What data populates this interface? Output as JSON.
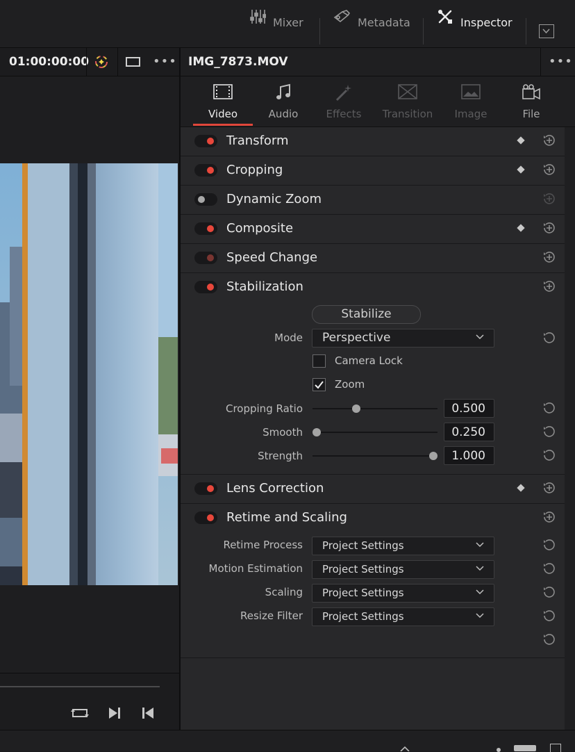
{
  "topbar": {
    "mixer_label": "Mixer",
    "metadata_label": "Metadata",
    "inspector_label": "Inspector",
    "icons": [
      "mixer-icon",
      "metadata-icon",
      "inspector-icon",
      "expand-icon"
    ]
  },
  "viewer": {
    "timecode": "01:00:00:00",
    "icons": [
      "color-wheel-icon",
      "aspect-ratio-icon",
      "more-options-icon",
      "loop-icon",
      "next-frame-icon",
      "previous-frame-icon"
    ]
  },
  "inspector": {
    "clip_name": "IMG_7873.MOV",
    "tabs": [
      {
        "label": "Video",
        "state": "active"
      },
      {
        "label": "Audio",
        "state": "normal"
      },
      {
        "label": "Effects",
        "state": "disabled"
      },
      {
        "label": "Transition",
        "state": "disabled"
      },
      {
        "label": "Image",
        "state": "disabled"
      },
      {
        "label": "File",
        "state": "normal"
      }
    ],
    "sections": {
      "transform": {
        "title": "Transform",
        "enabled": true
      },
      "cropping": {
        "title": "Cropping",
        "enabled": true
      },
      "dynamic_zoom": {
        "title": "Dynamic Zoom",
        "enabled": false
      },
      "composite": {
        "title": "Composite",
        "enabled": true
      },
      "speed_change": {
        "title": "Speed Change",
        "enabled": "partial"
      },
      "stabilization": {
        "title": "Stabilization",
        "enabled": true
      },
      "lens_correction": {
        "title": "Lens Correction",
        "enabled": true
      },
      "retime_scaling": {
        "title": "Retime and Scaling",
        "enabled": true
      }
    },
    "stabilization": {
      "stabilize_button": "Stabilize",
      "mode_label": "Mode",
      "mode_value": "Perspective",
      "camera_lock_label": "Camera Lock",
      "camera_lock_checked": false,
      "zoom_label": "Zoom",
      "zoom_checked": true,
      "cropping_ratio_label": "Cropping Ratio",
      "cropping_ratio_value": "0.500",
      "cropping_ratio_slider": 0.34,
      "smooth_label": "Smooth",
      "smooth_value": "0.250",
      "smooth_slider": 0.0,
      "strength_label": "Strength",
      "strength_value": "1.000",
      "strength_slider": 1.0
    },
    "retime": {
      "retime_process_label": "Retime Process",
      "retime_process_value": "Project Settings",
      "motion_estimation_label": "Motion Estimation",
      "motion_estimation_value": "Project Settings",
      "scaling_label": "Scaling",
      "scaling_value": "Project Settings",
      "resize_filter_label": "Resize Filter",
      "resize_filter_value": "Project Settings"
    }
  },
  "colors": {
    "accent_red": "#e8473b",
    "panel_bg": "#28282a",
    "header_bg": "#1f1f21"
  }
}
